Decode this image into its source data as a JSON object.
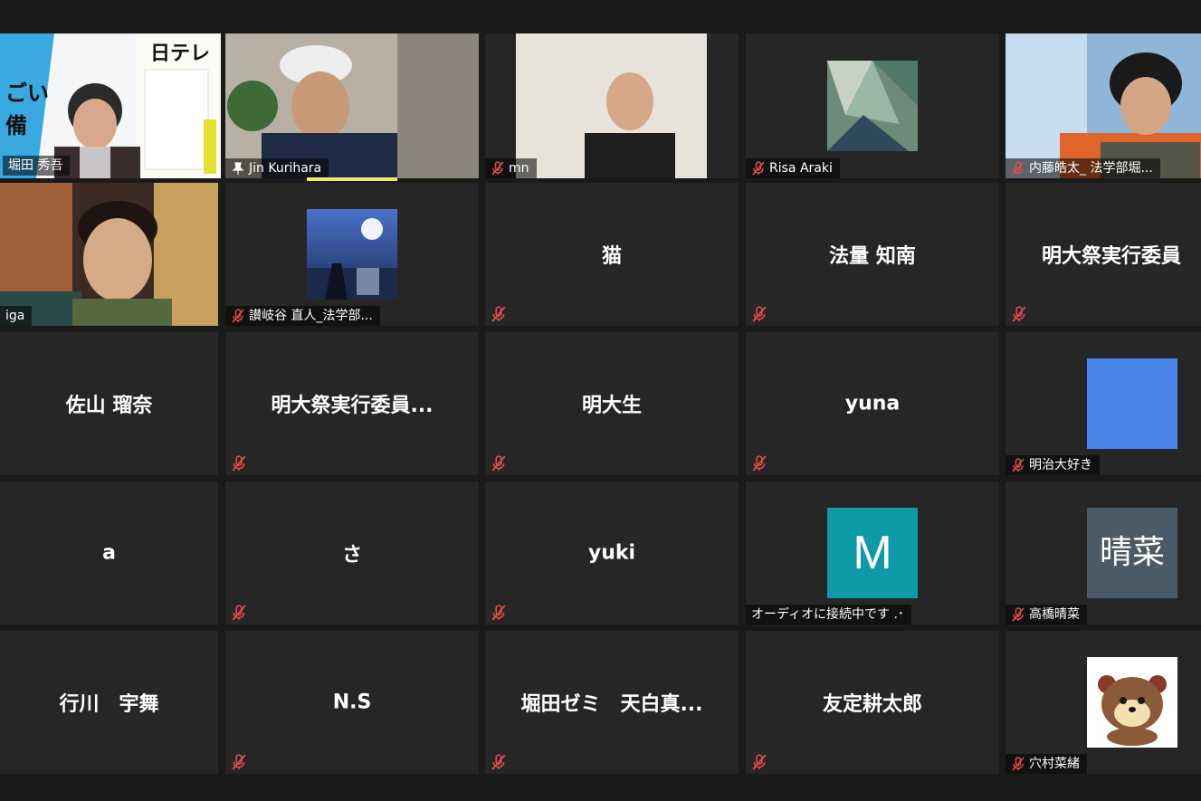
{
  "participants": [
    {
      "label": "堀田 秀吾",
      "muted": false,
      "video_overlay": "日テレ"
    },
    {
      "label": "Jin Kurihara",
      "muted": false,
      "pinned": true
    },
    {
      "label": "mn",
      "muted": true
    },
    {
      "label": "Risa Araki",
      "muted": true
    },
    {
      "label": "内藤皓太_ 法学部堀...",
      "muted": true
    },
    {
      "label": "iga",
      "muted": false
    },
    {
      "label": "讃岐谷 直人_法学部...",
      "muted": true
    },
    {
      "center": "猫",
      "muted": true
    },
    {
      "center": "法量 知南",
      "muted": true
    },
    {
      "center": "明大祭実行委員",
      "muted": true
    },
    {
      "center": "佐山 瑠奈",
      "muted": false
    },
    {
      "center": "明大祭実行委員...",
      "muted": true
    },
    {
      "center": "明大生",
      "muted": true
    },
    {
      "center": "yuna",
      "muted": true
    },
    {
      "label": "明治大好き",
      "muted": true,
      "avatar_color": "#4a86e8"
    },
    {
      "center": "a",
      "muted": false
    },
    {
      "center": "さ",
      "muted": true
    },
    {
      "center": "yuki",
      "muted": true
    },
    {
      "label": "オーディオに接続中です .･",
      "avatar_letter": "M",
      "avatar_color": "#0e9aa7"
    },
    {
      "label": "高橋晴菜",
      "muted": true,
      "avatar_letter": "晴菜",
      "avatar_color": "#4a5a66"
    },
    {
      "center": "行川　宇舞",
      "muted": false
    },
    {
      "center": "N.S",
      "muted": true
    },
    {
      "center": "堀田ゼミ　天白真...",
      "muted": true
    },
    {
      "center": "友定耕太郎",
      "muted": true
    },
    {
      "label": "穴村菜緒",
      "muted": true
    }
  ]
}
